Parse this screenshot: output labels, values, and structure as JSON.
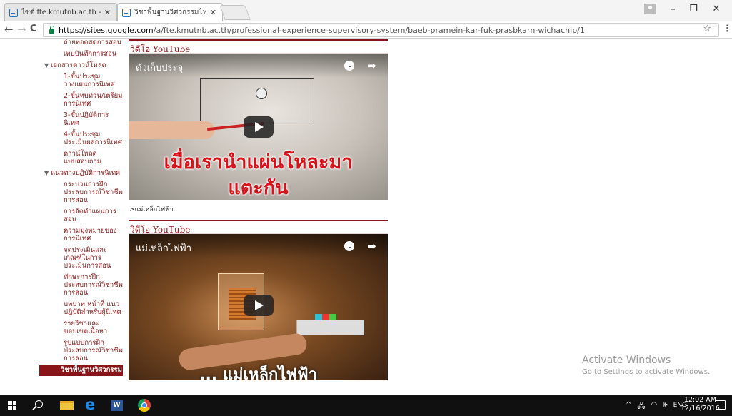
{
  "browser": {
    "tabs": [
      {
        "title": "ไซต์ fte.kmutnb.ac.th - Go",
        "active": false
      },
      {
        "title": "วิชาพื้นฐานวิศวกรรมไฟฟ้า (P",
        "active": true
      }
    ],
    "url_host": "https://sites.google.com",
    "url_path": "/a/fte.kmutnb.ac.th/professional-experience-supervisory-system/baeb-pramein-kar-fuk-prasbkarn-wichachip/1",
    "back_icon": "←",
    "forward_icon": "→",
    "reload_icon": "C",
    "star_icon": "☆",
    "menu_icon": "⋮",
    "minimize": "–",
    "maximize": "❐",
    "close": "✕",
    "tab_close": "✕"
  },
  "sidebar": {
    "items": [
      {
        "label": "ถ่ายทอดสดการสอน",
        "level": 2
      },
      {
        "label": "เทปบันทึกการสอน",
        "level": 2
      },
      {
        "label": "เอกสารดาวน์โหลด",
        "level": 1
      },
      {
        "label": "1-ขั้นประชุมวางแผนการนิเทศ",
        "level": 2
      },
      {
        "label": "2-ขั้นทบทวน/เตรียมการนิเทศ",
        "level": 2
      },
      {
        "label": "3-ขั้นปฏิบัติการนิเทศ",
        "level": 2
      },
      {
        "label": "4-ขั้นประชุมประเมินผลการนิเทศ",
        "level": 2
      },
      {
        "label": "ดาวน์โหลดแบบสอบถาม",
        "level": 2
      },
      {
        "label": "แนวทางปฏิบัติการนิเทศ",
        "level": 1
      },
      {
        "label": "กระบวนการฝึกประสบการณ์วิชาชีพการสอน",
        "level": 2
      },
      {
        "label": "การจัดทำแผนการสอน",
        "level": 2
      },
      {
        "label": "ความมุ่งหมายของการนิเทศ",
        "level": 2
      },
      {
        "label": "จุดประเมินและเกณฑ์ในการประเมินการสอน",
        "level": 2
      },
      {
        "label": "ทักษะการฝึกประสบการณ์วิชาชีพการสอน",
        "level": 2
      },
      {
        "label": "บทบาท หน้าที่ แนวปฏิบัติสำหรับผู้นิเทศ",
        "level": 2
      },
      {
        "label": "รายวิชาและขอบเขตเนื้อหา",
        "level": 2
      },
      {
        "label": "รูปแบบการฝึกประสบการณ์วิชาชีพการสอน",
        "level": 2
      },
      {
        "label": "วิชาพื้นฐานวิศวกรรม",
        "level": 2,
        "selected": true
      }
    ]
  },
  "main": {
    "section1_title": "วิดีโอ YouTube",
    "video1_title": "ตัวเก็บประจุ",
    "video1_caption_line1": "เมื่อเรานำแผ่นโหละมา",
    "video1_caption_line2": "แตะกัน",
    "link_text": ">แม่เหล็กไฟฟ้า",
    "section2_title": "วิดีโอ YouTube",
    "video2_title": "แม่เหล็กไฟฟ้า",
    "video2_caption": "... แม่เหล็กไฟฟ้า",
    "share_icon": "➦"
  },
  "watermark": {
    "line1": "Activate Windows",
    "line2": "Go to Settings to activate Windows."
  },
  "taskbar": {
    "edge_glyph": "e",
    "word_glyph": "W",
    "tray_up": "^",
    "tray_net": "🖧",
    "tray_wifi": "◠",
    "tray_vol": "🕪",
    "lang": "ENG",
    "time": "12:02 AM",
    "date": "12/16/2016"
  }
}
